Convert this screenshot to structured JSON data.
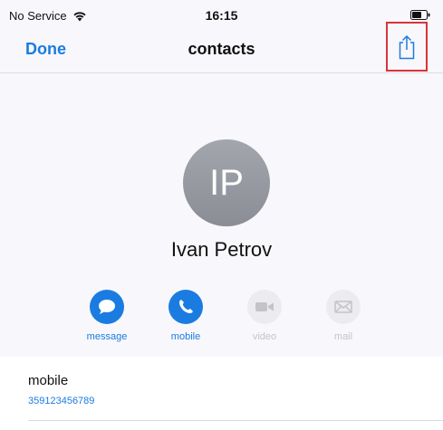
{
  "status_bar": {
    "carrier": "No Service",
    "time": "16:15"
  },
  "nav": {
    "done_label": "Done",
    "title": "contacts"
  },
  "contact": {
    "initials": "IP",
    "name": "Ivan Petrov"
  },
  "actions": [
    {
      "label": "message",
      "icon": "message-icon",
      "enabled": true
    },
    {
      "label": "mobile",
      "icon": "phone-icon",
      "enabled": true
    },
    {
      "label": "video",
      "icon": "video-icon",
      "enabled": false
    },
    {
      "label": "mail",
      "icon": "mail-icon",
      "enabled": false
    }
  ],
  "detail": {
    "label": "mobile",
    "value": "359123456789"
  },
  "colors": {
    "accent": "#1a7ce0",
    "highlight_border": "#d9343b",
    "background": "#f8f7fb"
  }
}
